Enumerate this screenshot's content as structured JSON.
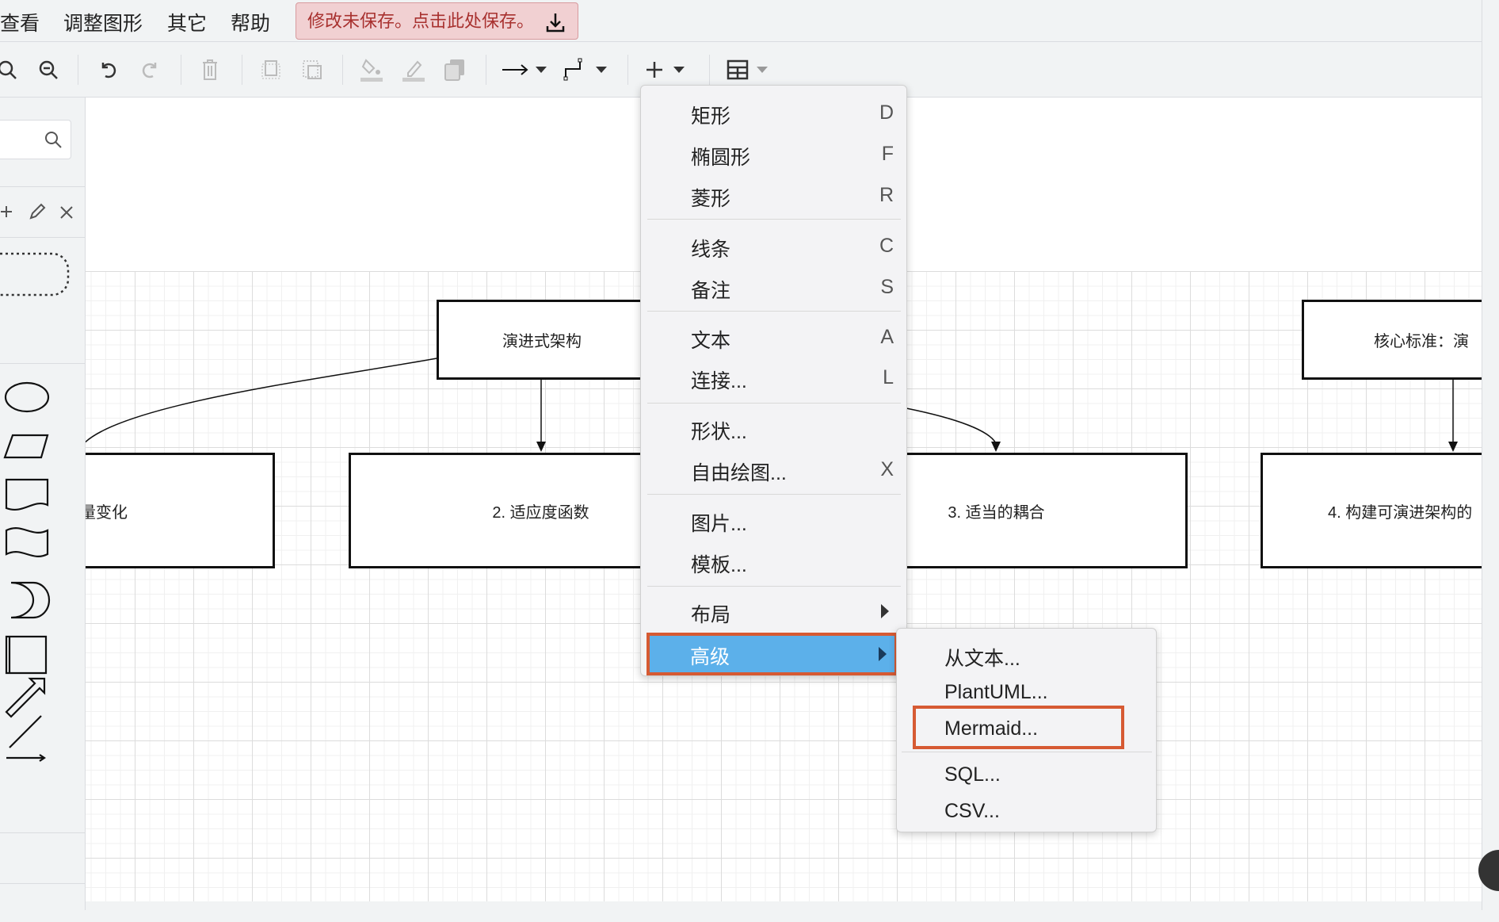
{
  "menubar": {
    "items": [
      "查看",
      "调整图形",
      "其它",
      "帮助"
    ],
    "save_notice": "修改未保存。点击此处保存。"
  },
  "toolbar": {
    "icons": [
      "zoom-in-icon",
      "zoom-out-icon",
      "undo-icon",
      "redo-icon",
      "delete-icon",
      "to-front-icon",
      "to-back-icon",
      "fill-color-icon",
      "line-color-icon",
      "shadow-icon",
      "connection-arrow-icon",
      "waypoint-icon",
      "insert-plus-icon",
      "table-icon"
    ]
  },
  "diagram": {
    "nodes": [
      "演进式架构",
      "量变化",
      "2. 适应度函数",
      "3. 适当的耦合",
      "4. 构建可演进架构的",
      "核心标准：演"
    ]
  },
  "insert_menu": {
    "items": [
      {
        "label": "矩形",
        "shortcut": "D"
      },
      {
        "label": "椭圆形",
        "shortcut": "F"
      },
      {
        "label": "菱形",
        "shortcut": "R"
      },
      {
        "label": "线条",
        "shortcut": "C"
      },
      {
        "label": "备注",
        "shortcut": "S"
      },
      {
        "label": "文本",
        "shortcut": "A"
      },
      {
        "label": "连接...",
        "shortcut": "L"
      },
      {
        "label": "形状...",
        "shortcut": ""
      },
      {
        "label": "自由绘图...",
        "shortcut": "X"
      },
      {
        "label": "图片...",
        "shortcut": ""
      },
      {
        "label": "模板...",
        "shortcut": ""
      },
      {
        "label": "布局",
        "shortcut": ""
      },
      {
        "label": "高级",
        "shortcut": ""
      }
    ],
    "highlighted": "高级"
  },
  "advanced_submenu": {
    "items": [
      "从文本...",
      "PlantUML...",
      "Mermaid...",
      "SQL...",
      "CSV..."
    ],
    "highlighted": "Mermaid..."
  },
  "colors": {
    "highlight": "#5cb0ea",
    "annotation": "#d65a33",
    "save_bg": "#f1d0d2",
    "save_text": "#a8312f"
  }
}
